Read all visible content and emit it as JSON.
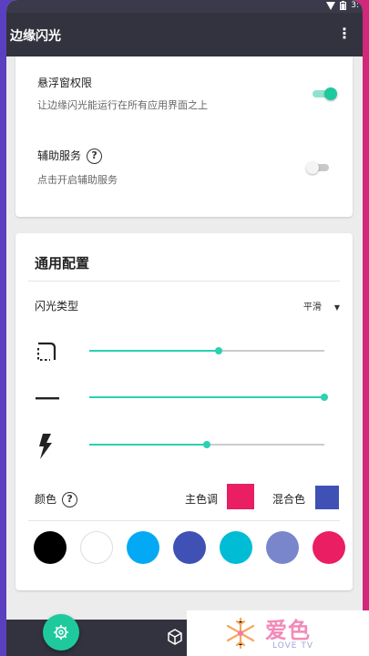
{
  "app": {
    "title": "边缘闪光"
  },
  "statusbar": {
    "time": "3:"
  },
  "permissions": {
    "overlay": {
      "title": "悬浮窗权限",
      "subtitle": "让边缘闪光能运行在所有应用界面之上",
      "enabled": true
    },
    "accessibility": {
      "title": "辅助服务",
      "subtitle": "点击开启辅助服务",
      "enabled": false,
      "help": "?"
    }
  },
  "general": {
    "title": "通用配置",
    "flash_type": {
      "label": "闪光类型",
      "value": "平滑"
    },
    "sliders": [
      {
        "icon": "border-corner-icon",
        "value": 0.55
      },
      {
        "icon": "line-width-icon",
        "value": 1.0
      },
      {
        "icon": "lightning-icon",
        "value": 0.5
      }
    ],
    "color": {
      "label": "颜色",
      "help": "?",
      "primary_label": "主色调",
      "primary_color": "#e91e63",
      "mix_label": "混合色",
      "mix_color": "#3f51b5"
    },
    "palette": [
      "#000000",
      "#ffffff",
      "#03a9f4",
      "#3f51b5",
      "#00bcd4",
      "#7986cb",
      "#e91e63"
    ]
  },
  "watermark": {
    "text": "爱色",
    "sub": "LOVE TV"
  }
}
